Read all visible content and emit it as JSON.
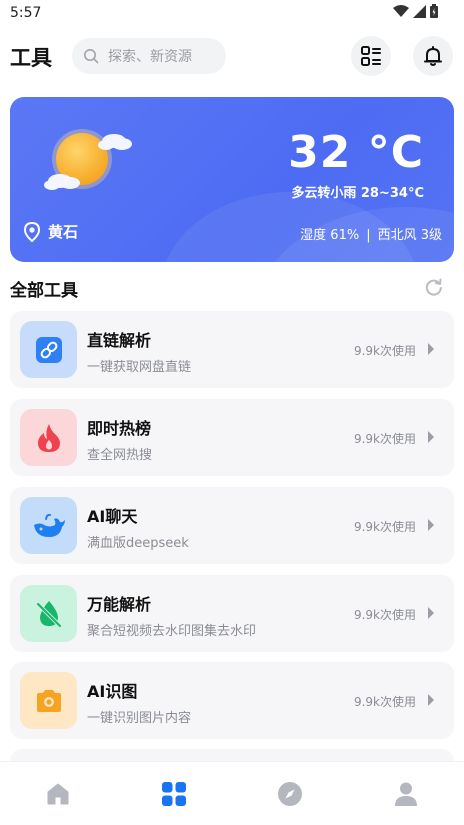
{
  "status": {
    "time": "5:57"
  },
  "header": {
    "title": "工具",
    "search_placeholder": "探索、新资源"
  },
  "weather": {
    "temperature": "32 °C",
    "description": "多云转小雨 28~34°C",
    "location": "黄石",
    "humidity": "湿度 61%",
    "separator": "|",
    "wind": "西北风 3级"
  },
  "section": {
    "title": "全部工具"
  },
  "tools": [
    {
      "name": "直链解析",
      "desc": "一键获取网盘直链",
      "uses": "9.9k次使用",
      "icon": "link-icon",
      "bg": "#c7dcfb",
      "fg": "#2f7ff7"
    },
    {
      "name": "即时热榜",
      "desc": "查全网热搜",
      "uses": "9.9k次使用",
      "icon": "fire-icon",
      "bg": "#fcd7da",
      "fg": "#f0414e"
    },
    {
      "name": "AI聊天",
      "desc": "满血版deepseek",
      "uses": "9.9k次使用",
      "icon": "whale-icon",
      "bg": "#c3dcfa",
      "fg": "#1f7ef0"
    },
    {
      "name": "万能解析",
      "desc": "聚合短视频去水印图集去水印",
      "uses": "9.9k次使用",
      "icon": "no-watermark-icon",
      "bg": "#c9f3df",
      "fg": "#18b66b"
    },
    {
      "name": "AI识图",
      "desc": "一键识别图片内容",
      "uses": "9.9k次使用",
      "icon": "camera-icon",
      "bg": "#fde7c4",
      "fg": "#f7a322"
    }
  ],
  "nav": {
    "items": [
      {
        "icon": "home-icon",
        "active": false
      },
      {
        "icon": "grid-icon",
        "active": true
      },
      {
        "icon": "compass-icon",
        "active": false
      },
      {
        "icon": "user-icon",
        "active": false
      }
    ],
    "active_color": "#1a73f0",
    "inactive_color": "#b4b7bd"
  }
}
